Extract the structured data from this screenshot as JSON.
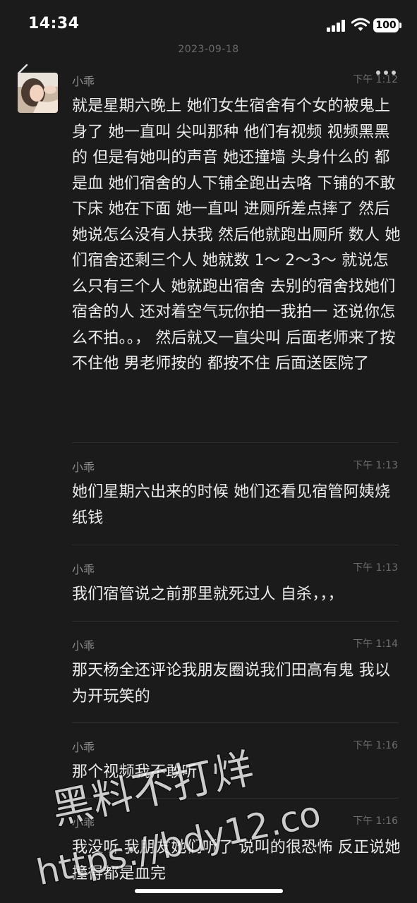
{
  "status_bar": {
    "time": "14:34",
    "battery": "100"
  },
  "date_header": "2023-09-18",
  "messages": [
    {
      "name": "小乖",
      "time": "下午 1:12",
      "text": "就是星期六晚上 她们女生宿舍有个女的被鬼上身了 她一直叫 尖叫那种 他们有视频 视频黑黑的 但是有她叫的声音 她还撞墙 头身什么的 都是血 她们宿舍的人下铺全跑出去咯 下铺的不敢下床 她在下面 她一直叫 进厕所差点摔了 然后她说怎么没有人扶我 然后他就跑出厕所 数人 她们宿舍还剩三个人 她就数 1～ 2～3～ 就说怎么只有三个人 她就跑出宿舍 去别的宿舍找她们宿舍的人 还对着空气玩你拍一我拍一 还说你怎么不拍。。，  然后就又一直尖叫 后面老师来了按不住他 男老师按的 都按不住 后面送医院了"
    },
    {
      "name": "小乖",
      "time": "下午 1:13",
      "text": "她们星期六出来的时候 她们还看见宿管阿姨烧纸钱"
    },
    {
      "name": "小乖",
      "time": "下午 1:13",
      "text": "我们宿管说之前那里就死过人 自杀，，，"
    },
    {
      "name": "小乖",
      "time": "下午 1:14",
      "text": "那天杨全还评论我朋友圈说我们田高有鬼 我以为开玩笑的"
    },
    {
      "name": "小乖",
      "time": "下午 1:16",
      "text": "那个视频我不敢听"
    },
    {
      "name": "小乖",
      "time": "下午 1:16",
      "text": "我没听 我朋友她们听了 说叫的很恐怖 反正说她撞得都是血完"
    }
  ],
  "watermark": {
    "line1": "黑料不打烊",
    "line2": "https://bdy12.co"
  },
  "icons": {
    "back": "chevron-left-icon",
    "more": "more-dots-icon",
    "avatar": "user-avatar"
  }
}
